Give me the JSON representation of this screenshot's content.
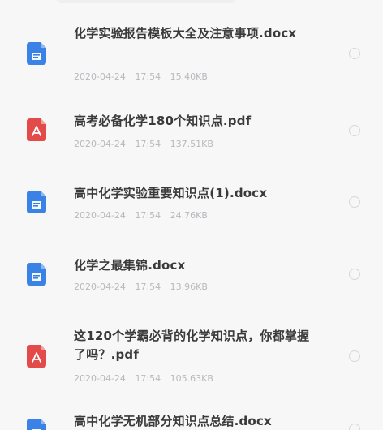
{
  "files": [
    {
      "type": "word",
      "name": "化学实验报告模板大全及注意事项.docx",
      "date": "2020-04-24",
      "time": "17:54",
      "size": "15.40KB"
    },
    {
      "type": "pdf",
      "name": "高考必备化学180个知识点.pdf",
      "date": "2020-04-24",
      "time": "17:54",
      "size": "137.51KB"
    },
    {
      "type": "word",
      "name": "高中化学实验重要知识点(1).docx",
      "date": "2020-04-24",
      "time": "17:54",
      "size": "24.76KB"
    },
    {
      "type": "word",
      "name": "化学之最集锦.docx",
      "date": "2020-04-24",
      "time": "17:54",
      "size": "13.96KB"
    },
    {
      "type": "pdf",
      "name": "这120个学霸必背的化学知识点，你都掌握了吗？.pdf",
      "date": "2020-04-24",
      "time": "17:54",
      "size": "105.63KB"
    },
    {
      "type": "word",
      "name": "高中化学无机部分知识点总结.docx",
      "date": "",
      "time": "",
      "size": ""
    }
  ],
  "colors": {
    "word_icon": "#3b82e6",
    "pdf_icon": "#e34a4a",
    "name_text": "#3a3a3a",
    "meta_text": "#b9b9bd",
    "background": "#f7f7f8"
  }
}
